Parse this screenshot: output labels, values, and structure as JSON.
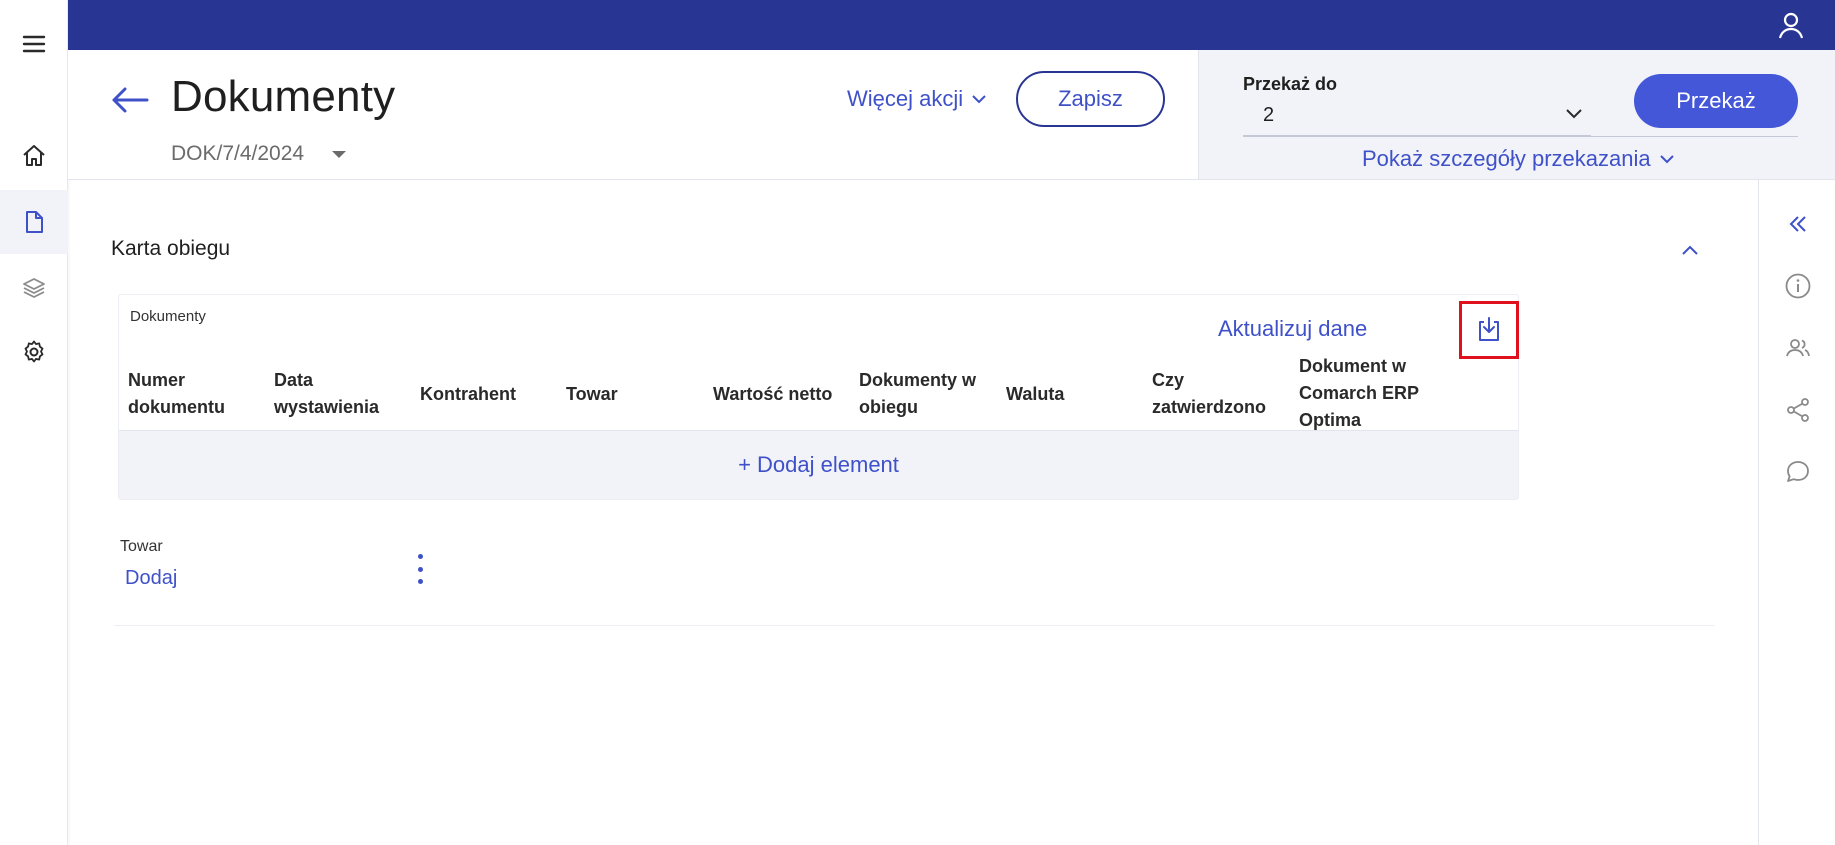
{
  "nav": {
    "menu_icon": "hamburger-menu-icon",
    "items": [
      {
        "id": "home",
        "icon": "home-icon"
      },
      {
        "id": "documents",
        "icon": "document-icon",
        "active": true
      },
      {
        "id": "layers",
        "icon": "layers-icon"
      },
      {
        "id": "settings",
        "icon": "gear-icon"
      }
    ]
  },
  "topbar": {
    "bg_color": "#293593",
    "user_icon": "user-icon"
  },
  "header": {
    "title": "Dokumenty",
    "doc_number": "DOK/7/4/2024",
    "more_actions_label": "Więcej akcji",
    "save_label": "Zapisz"
  },
  "transfer": {
    "label": "Przekaż do",
    "selected_value": "2",
    "button_label": "Przekaż",
    "details_label": "Pokaż szczegóły przekazania"
  },
  "section": {
    "title": "Karta obiegu"
  },
  "documents_table": {
    "caption": "Dokumenty",
    "update_label": "Aktualizuj dane",
    "download_icon": "download-icon",
    "columns": [
      [
        "Numer",
        "dokumentu"
      ],
      [
        "Data",
        "wystawienia"
      ],
      [
        "Kontrahent"
      ],
      [
        "Towar"
      ],
      [
        "Wartość netto"
      ],
      [
        "Dokumenty w",
        "obiegu"
      ],
      [
        "Waluta"
      ],
      [
        "Czy",
        "zatwierdzono"
      ],
      [
        "Dokument w",
        "Comarch ERP",
        "Optima"
      ]
    ],
    "add_label": "+ Dodaj element"
  },
  "goods": {
    "label": "Towar",
    "add_label": "Dodaj",
    "menu_icon": "more-vertical-icon"
  },
  "right_rail": {
    "items": [
      "double-chevron-left-icon",
      "info-icon",
      "users-icon",
      "share-icon",
      "comment-icon"
    ]
  },
  "colors": {
    "accent": "#3f51c9",
    "primary_button": "#4557d9",
    "highlight_border": "#e0101c",
    "panel_bg": "#f2f3f8"
  }
}
